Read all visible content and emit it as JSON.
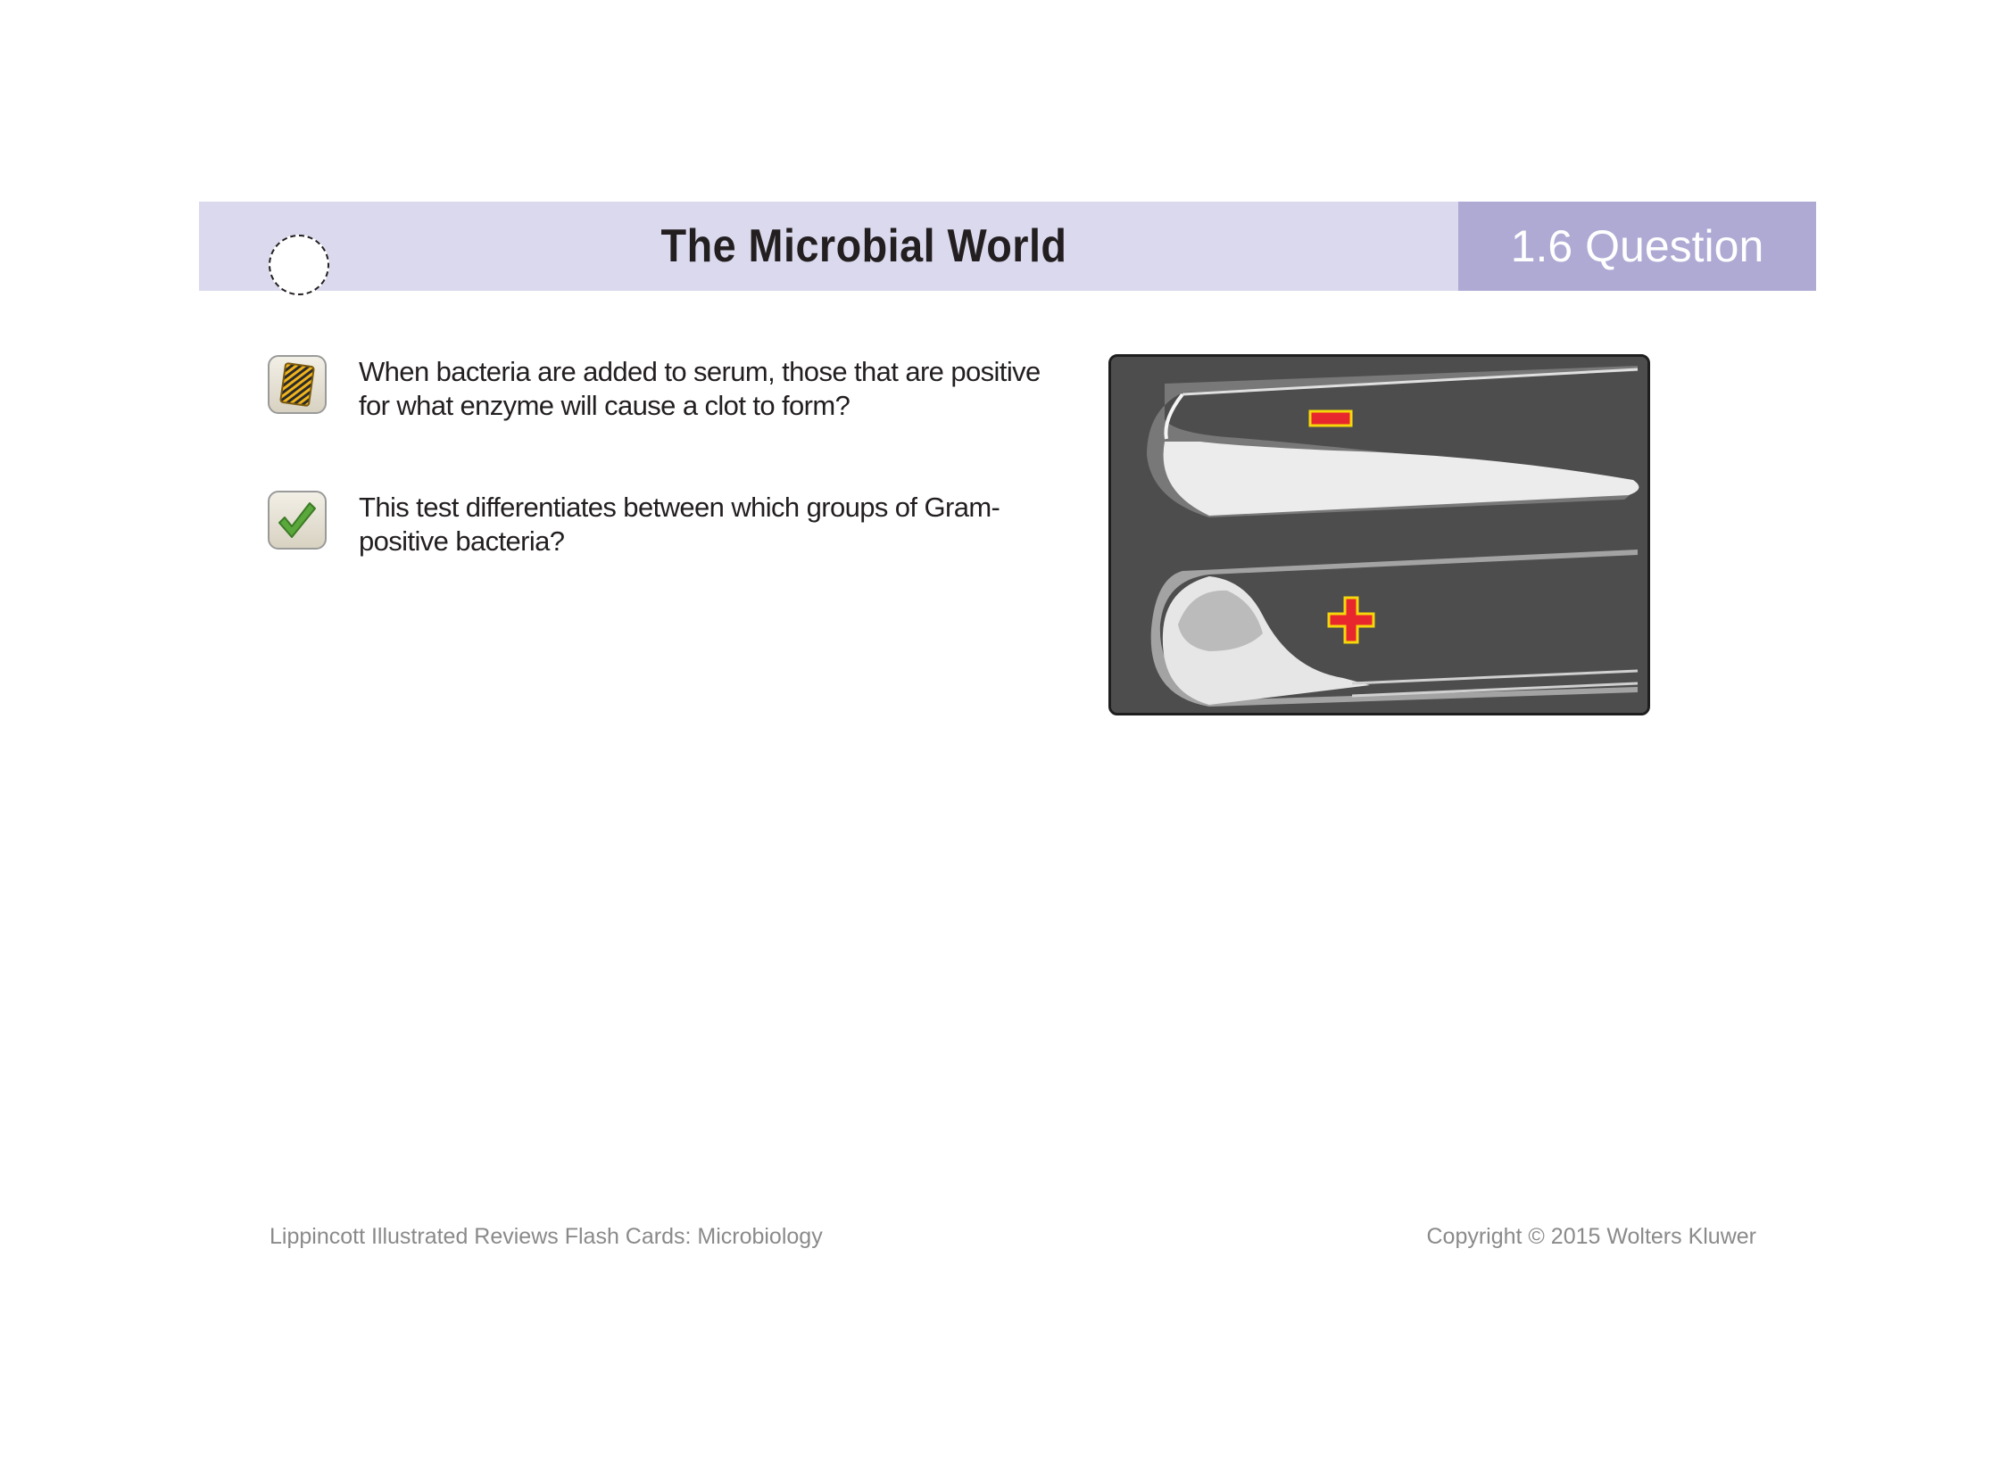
{
  "header": {
    "title": "The Microbial World",
    "section_label": "1.6 Question"
  },
  "questions": [
    {
      "icon": "flash-card-icon",
      "text": "When bacteria are added to serum, those that are positive for what enzyme will cause a clot to form?"
    },
    {
      "icon": "checkmark-icon",
      "text": "This test differentiates between which groups of Gram-positive bacteria?"
    }
  ],
  "figure": {
    "description_icon": "test-tube-photo",
    "marks": [
      "−",
      "+"
    ],
    "mark_color": "#e8262d",
    "mark_outline": "#f5d80a"
  },
  "footer": {
    "left": "Lippincott Illustrated Reviews Flash Cards: Microbiology",
    "right": "Copyright © 2015 Wolters Kluwer"
  },
  "colors": {
    "header_band": "#dbd9ee",
    "section_box": "#aeaad4"
  }
}
